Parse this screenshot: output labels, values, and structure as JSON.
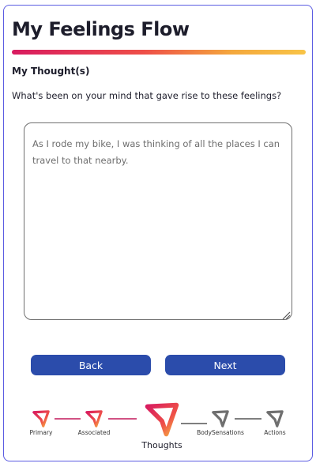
{
  "page": {
    "title": "My Feelings Flow",
    "section_label": "My Thought(s)",
    "question": "What's been on your mind that gave rise to these feelings?"
  },
  "thought_input": {
    "value": "As I rode my bike, I was thinking of all the places I can travel to that nearby."
  },
  "buttons": {
    "back_label": "Back",
    "next_label": "Next"
  },
  "flow_steps": [
    {
      "label": "Primary",
      "state": "completed"
    },
    {
      "label": "Associated",
      "state": "completed"
    },
    {
      "label": "Thoughts",
      "state": "current"
    },
    {
      "label": "BodySensations",
      "state": "upcoming"
    },
    {
      "label": "Actions",
      "state": "upcoming"
    }
  ],
  "colors": {
    "accent_blue": "#2b4cab",
    "card_border": "#5b5ce2",
    "gradient_start": "#d81b60",
    "gradient_end": "#f8c447",
    "inactive_gray": "#6f6f6f"
  }
}
